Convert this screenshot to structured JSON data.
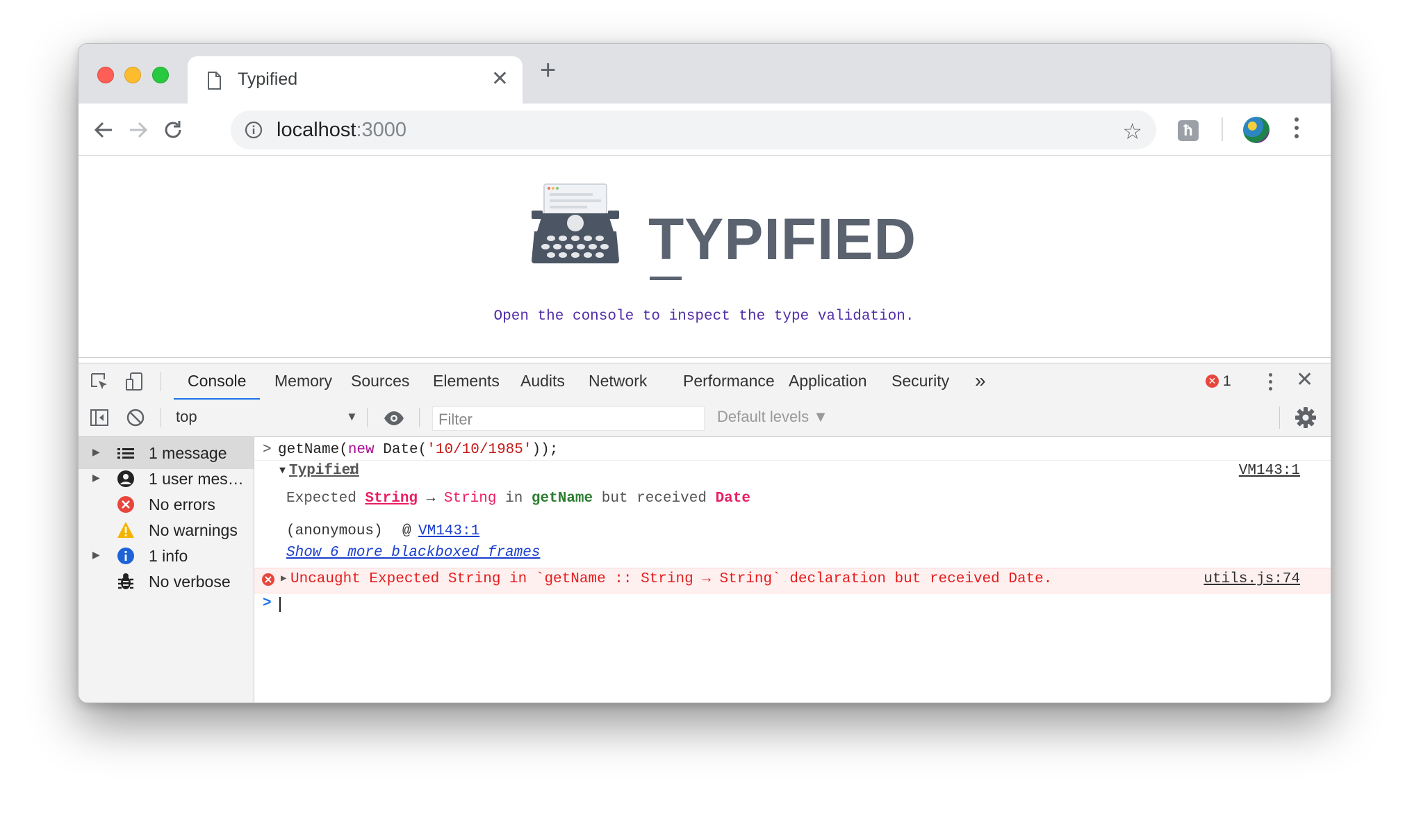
{
  "browser": {
    "tab_title": "Typified",
    "url_host": "localhost",
    "url_port": ":3000",
    "extension_letter": "ħ"
  },
  "page": {
    "brand": "TYPIFIED",
    "tagline": "Open the console to inspect the type validation."
  },
  "devtools": {
    "tabs": [
      "Console",
      "Memory",
      "Sources",
      "Elements",
      "Audits",
      "Network",
      "Performance",
      "Application",
      "Security"
    ],
    "overflow": "»",
    "error_count": "1",
    "context": "top",
    "filter_placeholder": "Filter",
    "levels": "Default levels ▼"
  },
  "sidebar": {
    "items": [
      {
        "label": "1 message",
        "icon": "list-icon"
      },
      {
        "label": "1 user mes…",
        "icon": "user-icon"
      },
      {
        "label": "No errors",
        "icon": "error-icon"
      },
      {
        "label": "No warnings",
        "icon": "warning-icon"
      },
      {
        "label": "1 info",
        "icon": "info-icon"
      },
      {
        "label": "No verbose",
        "icon": "bug-icon"
      }
    ]
  },
  "console": {
    "input": {
      "fn": "getName(",
      "kw": "new",
      "rest": " Date(",
      "str": "'10/10/1985'",
      "end": "));"
    },
    "group_label": "Typified",
    "group_colon": ":",
    "group_source": "VM143:1",
    "msg": {
      "p1": "Expected ",
      "t1": "String",
      "arrow": " → ",
      "t2": "String",
      "p2": " in ",
      "fn": "getName",
      "p3": " but received ",
      "t3": "Date"
    },
    "stack_fn": "(anonymous)",
    "stack_at": "@",
    "stack_src": "VM143:1",
    "blackbox": "Show 6 more blackboxed frames",
    "error_msg": "Uncaught Expected String in `getName :: String → String` declaration but received Date.",
    "error_source": "utils.js:74"
  }
}
